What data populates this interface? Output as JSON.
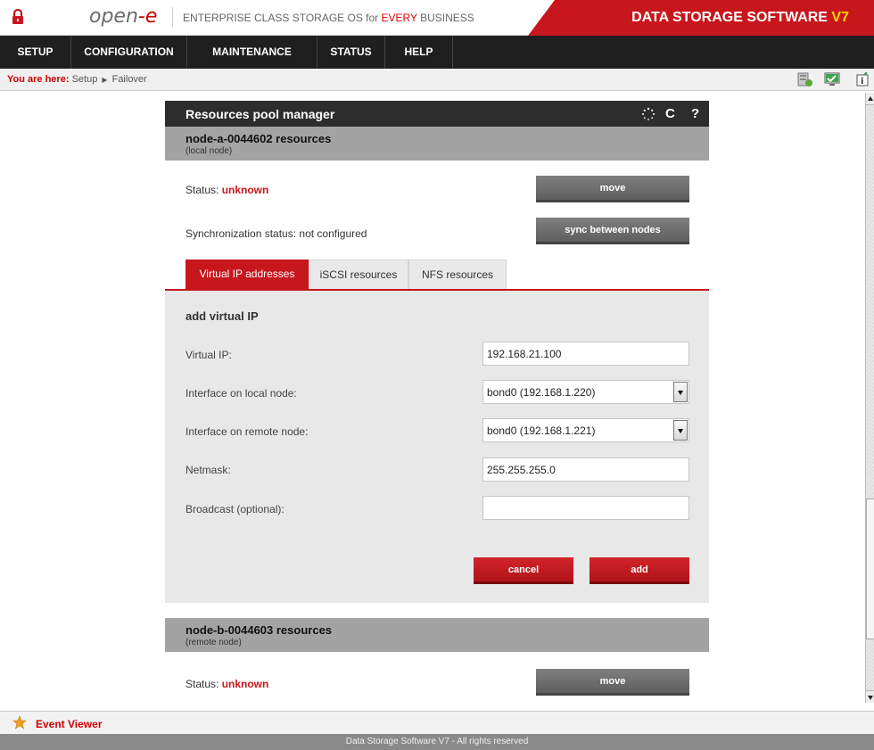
{
  "header": {
    "logo": "open-e",
    "tagline_pre": "ENTERPRISE CLASS STORAGE OS for ",
    "tagline_red": "EVERY",
    "tagline_post": " BUSINESS",
    "banner": "DATA STORAGE SOFTWARE ",
    "banner_version": "V7"
  },
  "nav": {
    "items": [
      {
        "label": "SETUP"
      },
      {
        "label": "CONFIGURATION"
      },
      {
        "label": "MAINTENANCE"
      },
      {
        "label": "STATUS"
      },
      {
        "label": "HELP"
      }
    ]
  },
  "breadcrumb": {
    "prefix": "You are here:",
    "first": "Setup",
    "second": "Failover"
  },
  "panel": {
    "title": "Resources pool manager",
    "node_a": {
      "title": "node-a-0044602 resources",
      "subtitle": "(local node)",
      "status_label": "Status: ",
      "status_value": "unknown",
      "move_label": "move",
      "sync_label": "Synchronization status: not configured",
      "sync_button": "sync between nodes"
    },
    "tabs": [
      {
        "label": "Virtual IP addresses",
        "active": true
      },
      {
        "label": "iSCSI resources",
        "active": false
      },
      {
        "label": "NFS resources",
        "active": false
      }
    ],
    "form": {
      "heading": "add virtual IP",
      "virtual_ip_label": "Virtual IP:",
      "virtual_ip_value": "192.168.21.100",
      "local_iface_label": "Interface on local node:",
      "local_iface_value": "bond0 (192.168.1.220)",
      "remote_iface_label": "Interface on remote node:",
      "remote_iface_value": "bond0 (192.168.1.221)",
      "netmask_label": "Netmask:",
      "netmask_value": "255.255.255.0",
      "broadcast_label": "Broadcast (optional):",
      "broadcast_value": "",
      "cancel_label": "cancel",
      "add_label": "add"
    },
    "node_b": {
      "title": "node-b-0044603 resources",
      "subtitle": "(remote node)",
      "status_label": "Status: ",
      "status_value": "unknown",
      "move_label": "move"
    }
  },
  "footer": {
    "event_viewer": "Event Viewer",
    "copyright": "Data Storage Software V7 - All rights reserved"
  },
  "colors": {
    "accent": "#c8161d",
    "nav_bg": "#1f1f1f",
    "node_header_bg": "#a3a3a3",
    "button_grey": "#6f6f6f"
  }
}
